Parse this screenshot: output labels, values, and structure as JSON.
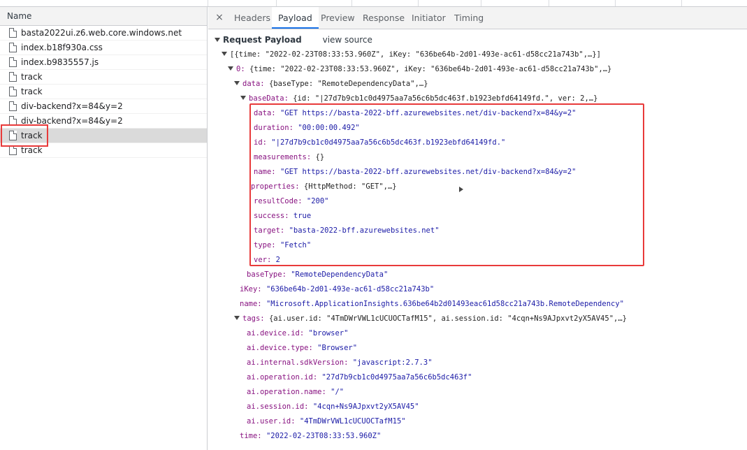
{
  "requests": {
    "header": "Name",
    "items": [
      {
        "name": "basta2022ui.z6.web.core.windows.net"
      },
      {
        "name": "index.b18f930a.css"
      },
      {
        "name": "index.b9835557.js"
      },
      {
        "name": "track"
      },
      {
        "name": "track"
      },
      {
        "name": "div-backend?x=84&y=2"
      },
      {
        "name": "div-backend?x=84&y=2"
      },
      {
        "name": "track",
        "selected": true
      },
      {
        "name": "track"
      }
    ]
  },
  "tabs": {
    "close": "×",
    "items": [
      "Headers",
      "Payload",
      "Preview",
      "Response",
      "Initiator",
      "Timing"
    ],
    "active": "Payload"
  },
  "payload": {
    "section_title": "Request Payload",
    "view_source": "view source",
    "root_summary": "[{time: \"2022-02-23T08:33:53.960Z\", iKey: \"636be64b-2d01-493e-ac61-d58cc21a743b\",…}]",
    "item0_key": "0:",
    "item0_summary": "{time: \"2022-02-23T08:33:53.960Z\", iKey: \"636be64b-2d01-493e-ac61-d58cc21a743b\",…}",
    "data_key": "data:",
    "data_summary": "{baseType: \"RemoteDependencyData\",…}",
    "baseData_key": "baseData:",
    "baseData_summary": "{id: \"|27d7b9cb1c0d4975aa7a56c6b5dc463f.b1923ebfd64149fd.\", ver: 2,…}",
    "baseData_fields": {
      "data_k": "data:",
      "data_v": "\"GET https://basta-2022-bff.azurewebsites.net/div-backend?x=84&y=2\"",
      "duration_k": "duration:",
      "duration_v": "\"00:00:00.492\"",
      "id_k": "id:",
      "id_v": "\"|27d7b9cb1c0d4975aa7a56c6b5dc463f.b1923ebfd64149fd.\"",
      "measurements_k": "measurements:",
      "measurements_v": "{}",
      "name_k": "name:",
      "name_v": "\"GET https://basta-2022-bff.azurewebsites.net/div-backend?x=84&y=2\"",
      "properties_k": "properties:",
      "properties_v": "{HttpMethod: \"GET\",…}",
      "resultCode_k": "resultCode:",
      "resultCode_v": "\"200\"",
      "success_k": "success:",
      "success_v": "true",
      "target_k": "target:",
      "target_v": "\"basta-2022-bff.azurewebsites.net\"",
      "type_k": "type:",
      "type_v": "\"Fetch\"",
      "ver_k": "ver:",
      "ver_v": "2"
    },
    "baseType_k": "baseType:",
    "baseType_v": "\"RemoteDependencyData\"",
    "iKey_k": "iKey:",
    "iKey_v": "\"636be64b-2d01-493e-ac61-d58cc21a743b\"",
    "name_k": "name:",
    "name_v": "\"Microsoft.ApplicationInsights.636be64b2d01493eac61d58cc21a743b.RemoteDependency\"",
    "tags_k": "tags:",
    "tags_summary": "{ai.user.id: \"4TmDWrVWL1cUCUOCTafM15\", ai.session.id: \"4cqn+Ns9AJpxvt2yX5AV45\",…}",
    "tags": {
      "device_id_k": "ai.device.id:",
      "device_id_v": "\"browser\"",
      "device_type_k": "ai.device.type:",
      "device_type_v": "\"Browser\"",
      "sdk_k": "ai.internal.sdkVersion:",
      "sdk_v": "\"javascript:2.7.3\"",
      "op_id_k": "ai.operation.id:",
      "op_id_v": "\"27d7b9cb1c0d4975aa7a56c6b5dc463f\"",
      "op_name_k": "ai.operation.name:",
      "op_name_v": "\"/\"",
      "session_k": "ai.session.id:",
      "session_v": "\"4cqn+Ns9AJpxvt2yX5AV45\"",
      "user_k": "ai.user.id:",
      "user_v": "\"4TmDWrVWL1cUCUOCTafM15\""
    },
    "time_k": "time:",
    "time_v": "\"2022-02-23T08:33:53.960Z\""
  },
  "colors": {
    "highlight": "#e83a3a",
    "key": "#881280",
    "string": "#1a1aa6",
    "tab_accent": "#1a73e8"
  }
}
